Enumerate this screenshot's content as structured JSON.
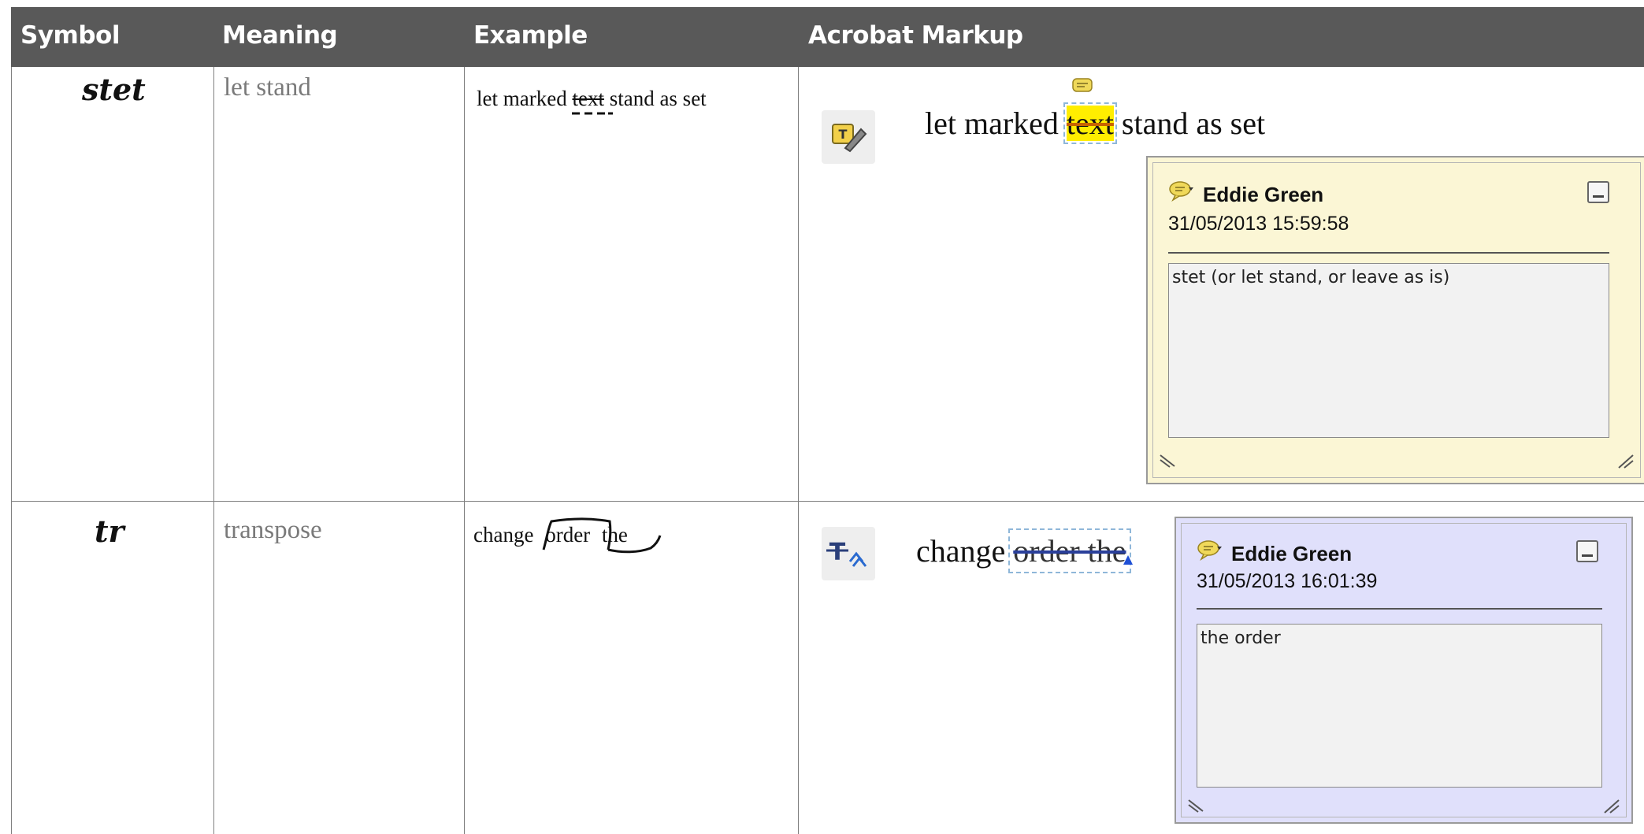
{
  "header": {
    "symbol": "Symbol",
    "meaning": "Meaning",
    "example": "Example",
    "markup": "Acrobat Markup"
  },
  "rows": [
    {
      "symbol": "stet",
      "meaning": "let stand",
      "example": {
        "before": "let marked ",
        "struck": "text",
        "after": " stand as set"
      },
      "markup": {
        "before": "let marked ",
        "highlighted": "text",
        "after": " stand as set",
        "tool_icon": "text-edit-icon",
        "popup": {
          "author": "Eddie Green",
          "date": "31/05/2013 15:59:58",
          "note": "stet (or let stand, or leave as is)",
          "background": "#fbf6d5"
        }
      }
    },
    {
      "symbol": "tr",
      "meaning": "transpose",
      "example": {
        "w1": "change",
        "w2": "order",
        "w3": "the"
      },
      "markup": {
        "before": "change ",
        "struck": "order the",
        "tool_icon": "replace-text-icon",
        "popup": {
          "author": "Eddie Green",
          "date": "31/05/2013 16:01:39",
          "note": "the order",
          "background": "#e0e0fb"
        }
      }
    }
  ],
  "colors": {
    "header_bg": "#595959",
    "highlight": "#ffee00",
    "comment_icon": "#f0d95a"
  }
}
